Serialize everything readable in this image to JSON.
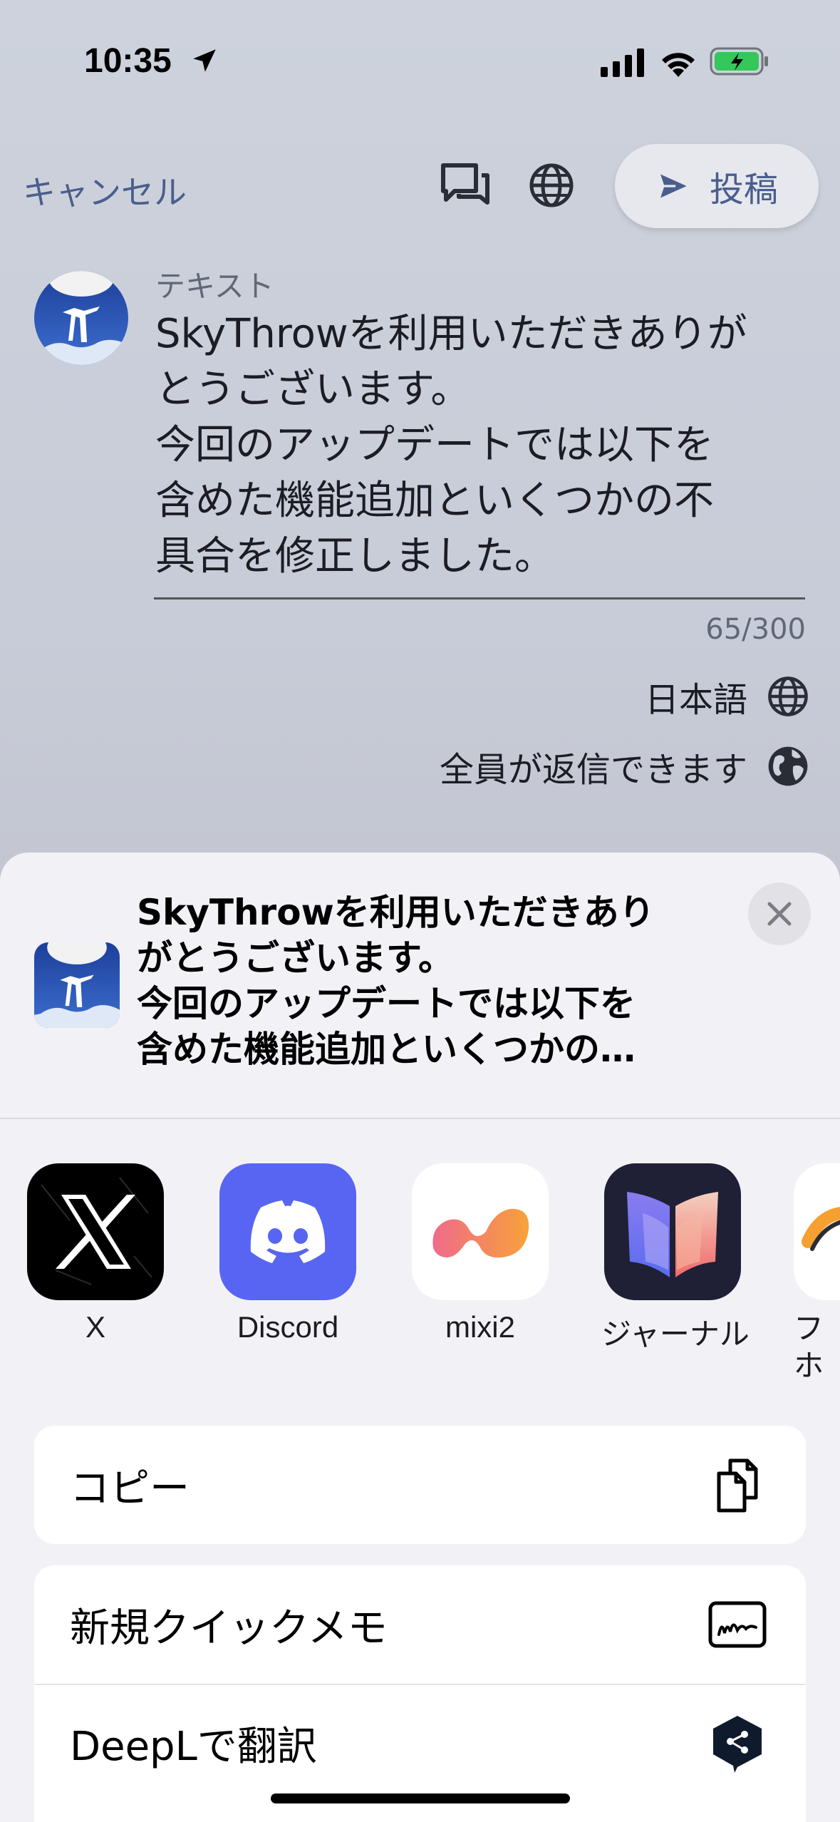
{
  "status_bar": {
    "time": "10:35"
  },
  "header": {
    "cancel_label": "キャンセル",
    "post_label": "投稿"
  },
  "compose": {
    "field_label": "テキスト",
    "text": "SkyThrowを利用いただきありが\nとうございます。\n今回のアップデートでは以下を\n含めた機能追加といくつかの不\n具合を修正しました。",
    "char_count": "65/300",
    "language": "日本語",
    "reply_setting": "全員が返信できます"
  },
  "share_sheet": {
    "preview_text": "SkyThrowを利用いただきあり\nがとうございます。\n今回のアップデートでは以下を\n含めた機能追加といくつかの…",
    "apps": [
      {
        "label": "X",
        "icon": "x-app-icon"
      },
      {
        "label": "Discord",
        "icon": "discord-app-icon"
      },
      {
        "label": "mixi2",
        "icon": "mixi2-app-icon"
      },
      {
        "label": "ジャーナル",
        "icon": "journal-app-icon"
      },
      {
        "label": "フ\nホ",
        "icon": "partial-app-icon"
      }
    ],
    "actions": [
      {
        "label": "コピー",
        "icon": "copy-icon"
      },
      {
        "label": "新規クイックメモ",
        "icon": "quick-note-icon"
      },
      {
        "label": "DeepLで翻訳",
        "icon": "deepl-icon"
      }
    ]
  },
  "colors": {
    "accent": "#4a5e8c",
    "discord": "#5865f2",
    "sheet_bg": "#f2f2f6"
  }
}
